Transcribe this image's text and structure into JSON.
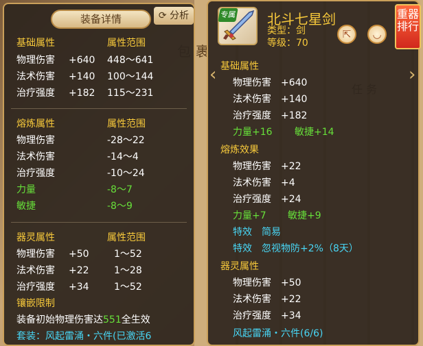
{
  "left_panel": {
    "header_title": "装备详情",
    "analyze_button": "分析",
    "base": {
      "section_label": "基础属性",
      "range_label": "属性范围",
      "rows": [
        {
          "name": "物理伤害",
          "value": "+640",
          "range": "448～641"
        },
        {
          "name": "法术伤害",
          "value": "+140",
          "range": "100～144"
        },
        {
          "name": "治疗强度",
          "value": "+182",
          "range": "115～231"
        }
      ]
    },
    "smelt": {
      "section_label": "熔炼属性",
      "range_label": "属性范围",
      "rows": [
        {
          "name": "物理伤害",
          "range": "-28～22"
        },
        {
          "name": "法术伤害",
          "range": "-14～4"
        },
        {
          "name": "治疗强度",
          "range": "-10～24"
        },
        {
          "name": "力量",
          "range": "-8～7"
        },
        {
          "name": "敏捷",
          "range": "-8～9"
        }
      ]
    },
    "spirit": {
      "section_label": "器灵属性",
      "range_label": "属性范围",
      "rows": [
        {
          "name": "物理伤害",
          "value": "+50",
          "range": "1～52"
        },
        {
          "name": "法术伤害",
          "value": "+22",
          "range": "1～28"
        },
        {
          "name": "治疗强度",
          "value": "+34",
          "range": "1～52"
        }
      ]
    },
    "inlay_label": "镶嵌限制",
    "inlay_text_prefix": "装备初始物理伤害达",
    "inlay_value": "551",
    "inlay_text_suffix": "全生效",
    "set_label": "套装：",
    "set_text": "风起雷涌・六件(已激活6"
  },
  "right_panel": {
    "exclusive_tag": "专属",
    "weapon_name": "北斗七星剑",
    "type_text": "类型：剑",
    "level_text": "等级：70",
    "rank_button": "重器排行",
    "base": {
      "section_label": "基础属性",
      "rows": [
        {
          "name": "物理伤害",
          "value": "+640"
        },
        {
          "name": "法术伤害",
          "value": "+140"
        },
        {
          "name": "治疗强度",
          "value": "+182"
        }
      ],
      "green_a": "力量+16",
      "green_b": "敏捷+14"
    },
    "smelt": {
      "section_label": "熔炼效果",
      "rows": [
        {
          "name": "物理伤害",
          "value": "+22"
        },
        {
          "name": "法术伤害",
          "value": "+4"
        },
        {
          "name": "治疗强度",
          "value": "+24"
        }
      ],
      "green_a": "力量+7",
      "green_b": "敏捷+9",
      "effect1_label": "特效",
      "effect1_value": "简易",
      "effect2_label": "特效",
      "effect2_value": "忽视物防+2%（8天）"
    },
    "spirit": {
      "section_label": "器灵属性",
      "rows": [
        {
          "name": "物理伤害",
          "value": "+50"
        },
        {
          "name": "法术伤害",
          "value": "+22"
        },
        {
          "name": "治疗强度",
          "value": "+34"
        }
      ]
    },
    "set_text": "风起雷涌・六件(6/6)"
  },
  "background": {
    "bag_tab": "包",
    "bag_tab2": "裹",
    "task_tab": "任  务"
  },
  "icons": [
    "refresh-icon",
    "share-icon",
    "eye-icon",
    "sword-icon",
    "left-arrow-icon",
    "right-arrow-icon"
  ]
}
